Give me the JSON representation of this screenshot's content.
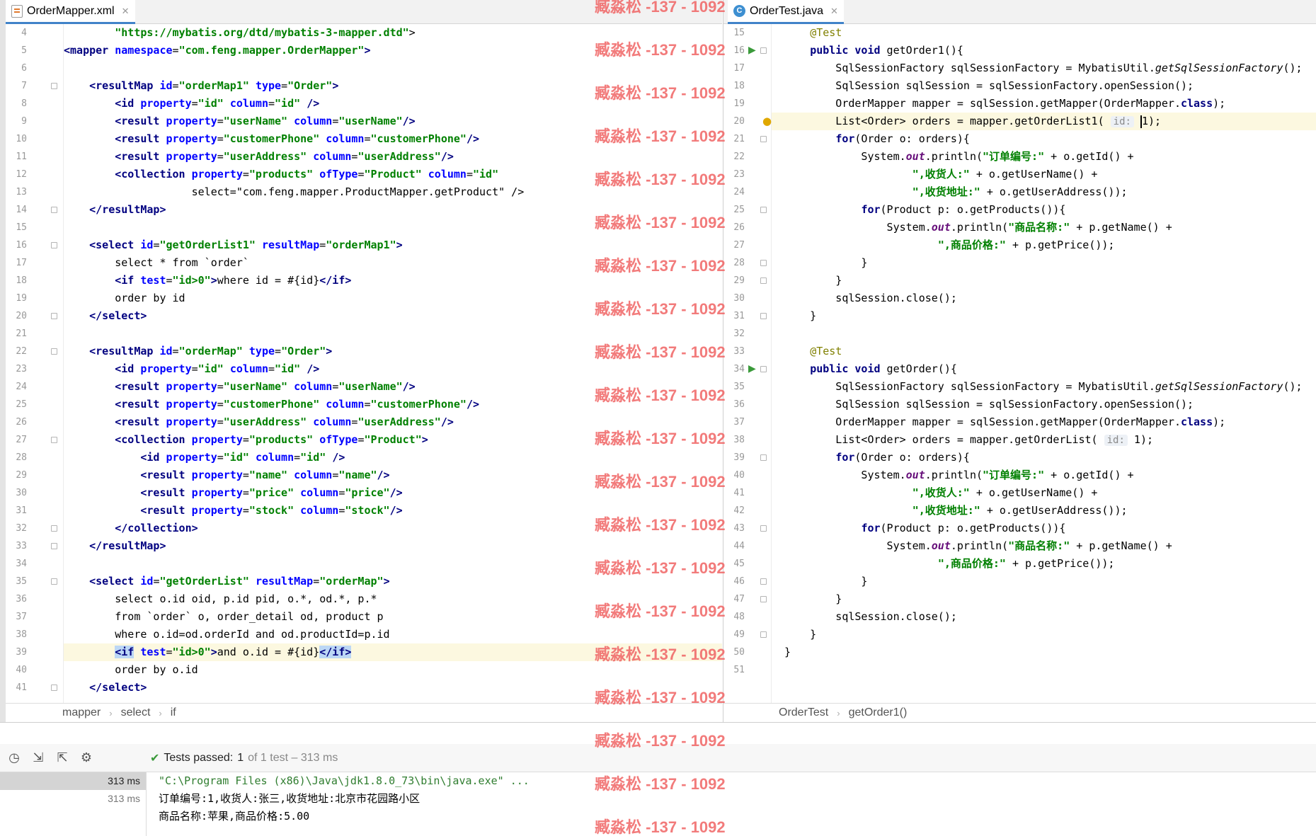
{
  "left_editor": {
    "tab_label": "OrderMapper.xml",
    "line_numbers": [
      4,
      5,
      6,
      7,
      8,
      9,
      10,
      11,
      12,
      13,
      14,
      15,
      16,
      17,
      18,
      19,
      20,
      21,
      22,
      23,
      24,
      25,
      26,
      27,
      28,
      29,
      30,
      31,
      32,
      33,
      34,
      35,
      36,
      37,
      38,
      39,
      40,
      41
    ],
    "lines": [
      "\"https://mybatis.org/dtd/mybatis-3-mapper.dtd\">",
      "<mapper namespace=\"com.feng.mapper.OrderMapper\">",
      "",
      "<resultMap id=\"orderMap1\" type=\"Order\">",
      "<id property=\"id\" column=\"id\" />",
      "<result property=\"userName\" column=\"userName\"/>",
      "<result property=\"customerPhone\" column=\"customerPhone\"/>",
      "<result property=\"userAddress\" column=\"userAddress\"/>",
      "<collection property=\"products\" ofType=\"Product\" column=\"id\"",
      "select=\"com.feng.mapper.ProductMapper.getProduct\" />",
      "</resultMap>",
      "",
      "<select id=\"getOrderList1\" resultMap=\"orderMap1\">",
      "select * from `order`",
      "<if test=\"id>0\">where id = #{id}</if>",
      "order by id",
      "</select>",
      "",
      "<resultMap id=\"orderMap\" type=\"Order\">",
      "<id property=\"id\" column=\"id\" />",
      "<result property=\"userName\" column=\"userName\"/>",
      "<result property=\"customerPhone\" column=\"customerPhone\"/>",
      "<result property=\"userAddress\" column=\"userAddress\"/>",
      "<collection property=\"products\" ofType=\"Product\">",
      "<id property=\"id\" column=\"id\" />",
      "<result property=\"name\" column=\"name\"/>",
      "<result property=\"price\" column=\"price\"/>",
      "<result property=\"stock\" column=\"stock\"/>",
      "</collection>",
      "</resultMap>",
      "",
      "<select id=\"getOrderList\" resultMap=\"orderMap\">",
      "select o.id oid, p.id pid, o.*, od.*, p.*",
      "from `order` o, order_detail od, product p",
      "where o.id=od.orderId and od.productId=p.id",
      "<if test=\"id>0\">and o.id = #{id}</if>",
      "order by o.id",
      "</select>"
    ],
    "breadcrumb": [
      "mapper",
      "select",
      "if"
    ]
  },
  "right_editor": {
    "tab_label": "OrderTest.java",
    "line_numbers": [
      15,
      16,
      17,
      18,
      19,
      20,
      21,
      22,
      23,
      24,
      25,
      26,
      27,
      28,
      29,
      30,
      31,
      32,
      33,
      34,
      35,
      36,
      37,
      38,
      39,
      40,
      41,
      42,
      43,
      44,
      45,
      46,
      47,
      48,
      49,
      50,
      51
    ],
    "lines": [
      "@Test",
      "public void getOrder1(){",
      "SqlSessionFactory sqlSessionFactory = MybatisUtil.getSqlSessionFactory();",
      "SqlSession sqlSession = sqlSessionFactory.openSession();",
      "OrderMapper mapper = sqlSession.getMapper(OrderMapper.class);",
      "List<Order> orders = mapper.getOrderList1( id: 1);",
      "for(Order o: orders){",
      "System.out.println(\"订单编号:\" + o.getId() +",
      "\",收货人:\" + o.getUserName() +",
      "\",收货地址:\" + o.getUserAddress());",
      "for(Product p: o.getProducts()){",
      "System.out.println(\"商品名称:\" + p.getName() +",
      "\",商品价格:\" + p.getPrice());",
      "}",
      "}",
      "sqlSession.close();",
      "}",
      "",
      "@Test",
      "public void getOrder(){",
      "SqlSessionFactory sqlSessionFactory = MybatisUtil.getSqlSessionFactory();",
      "SqlSession sqlSession = sqlSessionFactory.openSession();",
      "OrderMapper mapper = sqlSession.getMapper(OrderMapper.class);",
      "List<Order> orders = mapper.getOrderList( id: 1);",
      "for(Order o: orders){",
      "System.out.println(\"订单编号:\" + o.getId() +",
      "\",收货人:\" + o.getUserName() +",
      "\",收货地址:\" + o.getUserAddress());",
      "for(Product p: o.getProducts()){",
      "System.out.println(\"商品名称:\" + p.getName() +",
      "\",商品价格:\" + p.getPrice());",
      "}",
      "}",
      "sqlSession.close();",
      "}",
      "}",
      ""
    ],
    "breadcrumb": [
      "OrderTest",
      "getOrder1()"
    ]
  },
  "watermark": {
    "text": "臧淼松 -137 - 1092"
  },
  "run_panel": {
    "status_prefix": "Tests passed:",
    "passed_count": "1",
    "status_suffix": "of 1 test – 313 ms",
    "tree_times": [
      "313 ms",
      "313 ms"
    ],
    "console_lines": [
      "\"C:\\Program Files (x86)\\Java\\jdk1.8.0_73\\bin\\java.exe\" ...",
      "订单编号:1,收货人:张三,收货地址:北京市花园路小区",
      "商品名称:苹果,商品价格:5.00"
    ]
  },
  "colors": {
    "xml_tag": "#000080",
    "xml_attr": "#0000ff",
    "string": "#008000",
    "watermark": "#f06464",
    "current_line": "#fcf8e0"
  },
  "icons": {
    "xml_file": "xml-file-icon",
    "java_class": "java-class-icon",
    "run_gutter": "run-test-icon",
    "intention": "lightbulb-icon",
    "check": "check-icon"
  }
}
